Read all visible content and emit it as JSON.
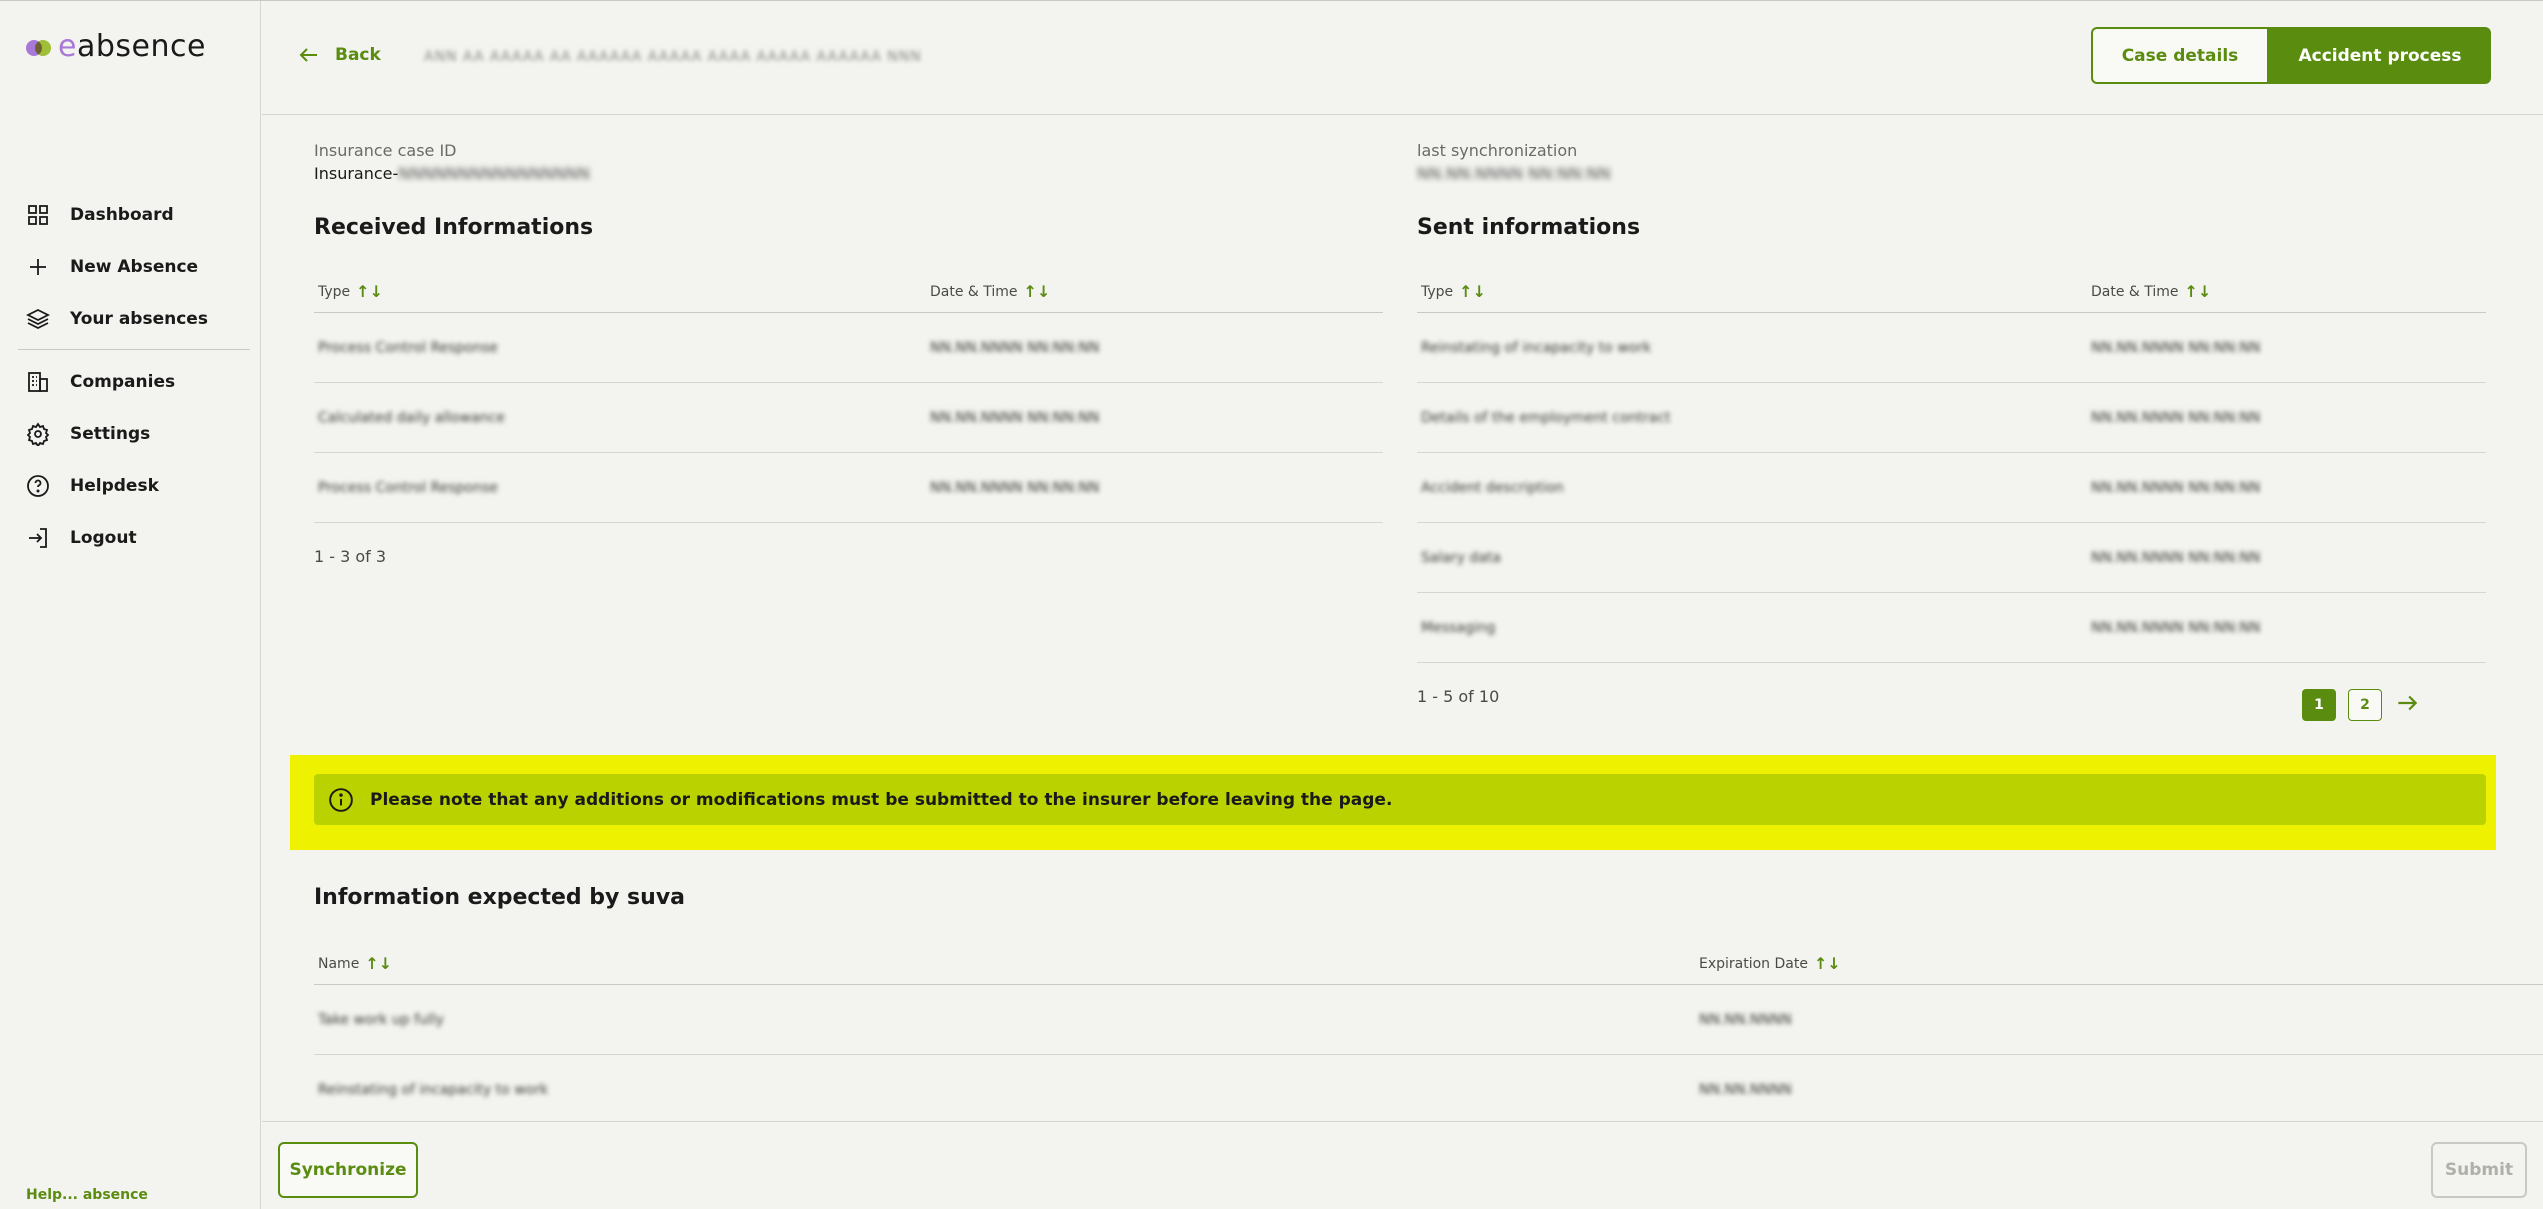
{
  "app": {
    "logo_text": "absence",
    "logo_prefix": "e",
    "footer_text": "Help... absence"
  },
  "sidebar": {
    "items": [
      {
        "label": "Dashboard",
        "icon": "grid-icon"
      },
      {
        "label": "New Absence",
        "icon": "plus-icon"
      },
      {
        "label": "Your absences",
        "icon": "layers-icon"
      },
      {
        "label": "Companies",
        "icon": "building-icon"
      },
      {
        "label": "Settings",
        "icon": "gear-icon"
      },
      {
        "label": "Helpdesk",
        "icon": "help-circle-icon"
      },
      {
        "label": "Logout",
        "icon": "logout-icon"
      }
    ]
  },
  "header": {
    "back_label": "Back",
    "breadcrumb": "ANN AA AAAAA AA AAAAAA      AAAAA AAAA AAAAA AAAAAA NNN",
    "tab_case_details": "Case details",
    "tab_accident_process": "Accident process"
  },
  "meta": {
    "case_id_label": "Insurance case ID",
    "case_id_prefix": "Insurance-",
    "case_id_value": "NNNNNNNNNNNNNNNN",
    "sync_label": "last synchronization",
    "sync_value": "NN.NN.NNNN NN:NN:NN"
  },
  "received": {
    "title": "Received Informations",
    "col_type": "Type",
    "col_date": "Date & Time",
    "rows": [
      {
        "type": "Process Control Response",
        "date": "NN.NN.NNNN NN:NN:NN"
      },
      {
        "type": "Calculated daily allowance",
        "date": "NN.NN.NNNN NN:NN:NN"
      },
      {
        "type": "Process Control Response",
        "date": "NN.NN.NNNN NN:NN:NN"
      }
    ],
    "footer": "1 - 3 of 3"
  },
  "sent": {
    "title": "Sent informations",
    "col_type": "Type",
    "col_date": "Date & Time",
    "rows": [
      {
        "type": "Reinstating of incapacity to work",
        "date": "NN.NN.NNNN NN:NN:NN"
      },
      {
        "type": "Details of the employment contract",
        "date": "NN.NN.NNNN NN:NN:NN"
      },
      {
        "type": "Accident description",
        "date": "NN.NN.NNNN NN:NN:NN"
      },
      {
        "type": "Salary data",
        "date": "NN.NN.NNNN NN:NN:NN"
      },
      {
        "type": "Messaging",
        "date": "NN.NN.NNNN NN:NN:NN"
      }
    ],
    "footer": "1 - 5 of 10",
    "pages": [
      "1",
      "2"
    ]
  },
  "notice": {
    "text": "Please note that any additions or modifications must be submitted to the insurer before leaving the page."
  },
  "expected": {
    "title": "Information expected by suva",
    "col_name": "Name",
    "col_exp": "Expiration Date",
    "rows": [
      {
        "name": "Take work up fully",
        "date": "NN.NN.NNNN"
      },
      {
        "name": "Reinstating of incapacity to work",
        "date": "NN.NN.NNNN"
      }
    ]
  },
  "actions": {
    "synchronize": "Synchronize",
    "submit": "Submit"
  },
  "colors": {
    "accent": "#5a8c10",
    "notice_outer": "#eef200",
    "notice_inner": "#b9d200",
    "logo_purple": "#a979d8"
  }
}
